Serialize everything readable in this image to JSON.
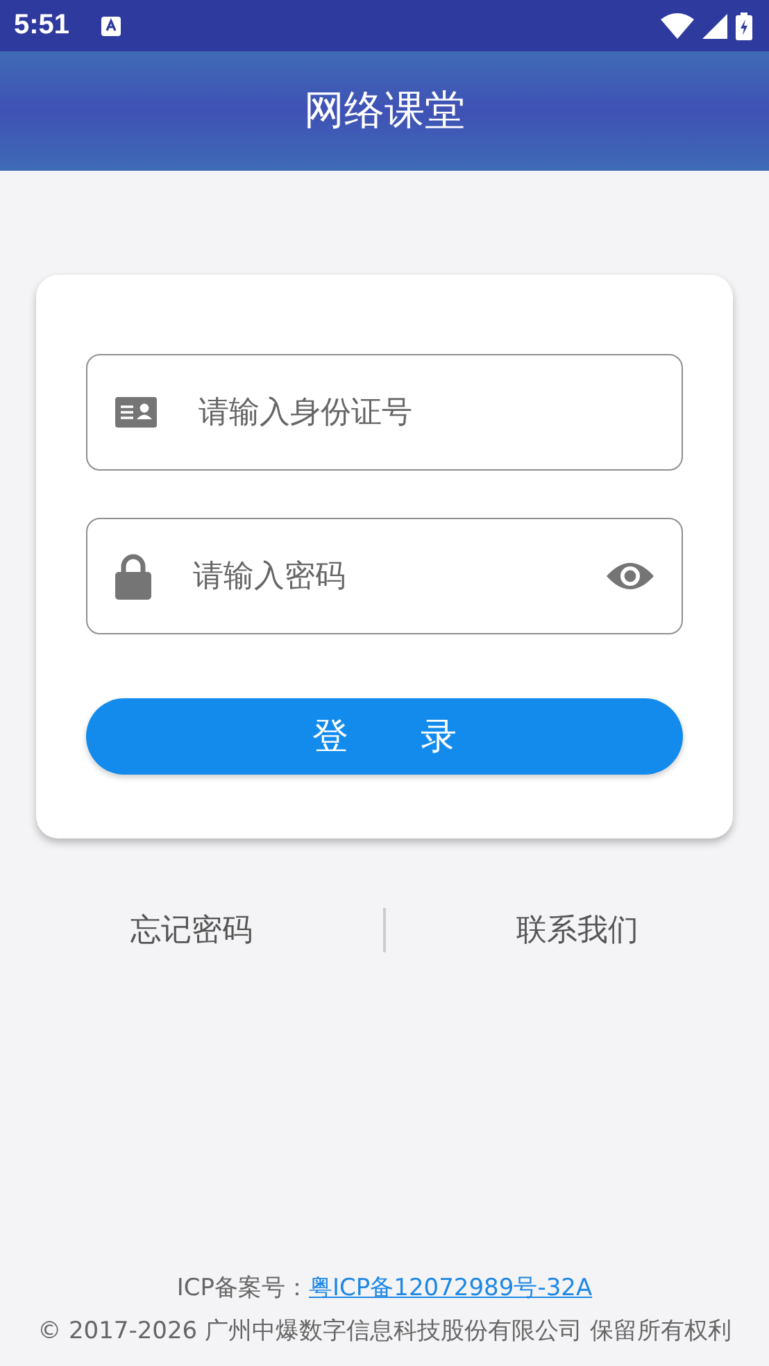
{
  "status_bar": {
    "time": "5:51"
  },
  "header": {
    "title": "网络课堂"
  },
  "form": {
    "id_field": {
      "placeholder": "请输入身份证号"
    },
    "password_field": {
      "placeholder": "请输入密码"
    },
    "login_button": "登　　录"
  },
  "links": [
    {
      "label": "忘记密码"
    },
    {
      "label": "联系我们"
    }
  ],
  "footer": {
    "icp_label": "ICP备案号：",
    "icp_link": "粤ICP备12072989号-32A",
    "copyright": "© 2017-2026 广州中爆数字信息科技股份有限公司 保留所有权利"
  }
}
